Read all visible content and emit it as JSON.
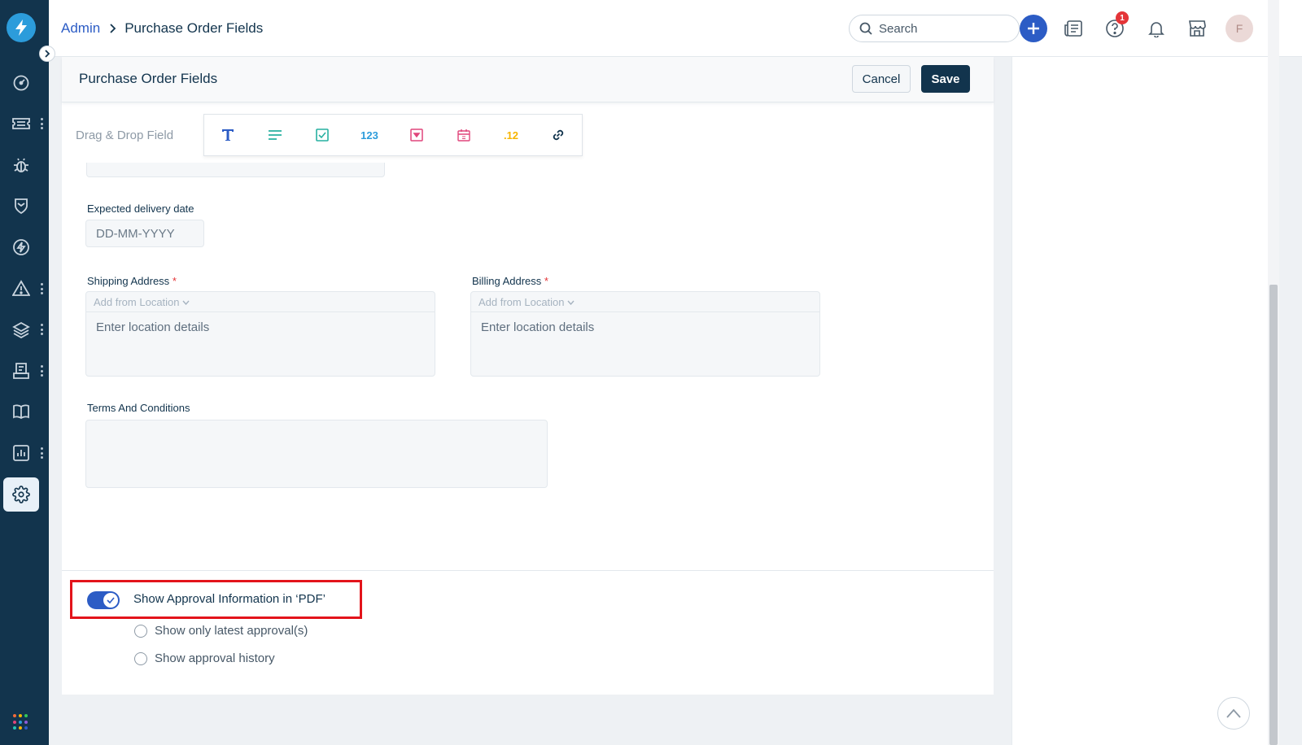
{
  "breadcrumb": {
    "parent": "Admin",
    "current": "Purchase Order Fields"
  },
  "search": {
    "placeholder": "Search"
  },
  "help": {
    "badge_count": "1"
  },
  "user": {
    "avatar_initial": "F"
  },
  "card": {
    "title": "Purchase Order Fields",
    "cancel_label": "Cancel",
    "save_label": "Save"
  },
  "toolbar": {
    "label": "Drag & Drop Field",
    "tools": [
      {
        "icon": "text-field-icon",
        "glyph": "T"
      },
      {
        "icon": "paragraph-field-icon",
        "glyph": ""
      },
      {
        "icon": "checkbox-field-icon",
        "glyph": ""
      },
      {
        "icon": "number-field-icon",
        "glyph": "123"
      },
      {
        "icon": "dropdown-field-icon",
        "glyph": ""
      },
      {
        "icon": "date-field-icon",
        "glyph": ""
      },
      {
        "icon": "decimal-field-icon",
        "glyph": ".12"
      },
      {
        "icon": "url-field-icon",
        "glyph": ""
      }
    ]
  },
  "fields": {
    "expected_delivery": {
      "label": "Expected delivery date",
      "placeholder": "DD-MM-YYYY"
    },
    "shipping": {
      "label": "Shipping Address",
      "required_mark": "*",
      "add_from": "Add from Location",
      "placeholder": "Enter location details"
    },
    "billing": {
      "label": "Billing Address",
      "required_mark": "*",
      "add_from": "Add from Location",
      "placeholder": "Enter location details"
    },
    "terms": {
      "label": "Terms And Conditions"
    }
  },
  "approval": {
    "toggle_label": "Show Approval Information in ‘PDF’",
    "toggle_on": true,
    "options": [
      "Show only latest approval(s)",
      "Show approval history"
    ]
  },
  "colors": {
    "sidebar": "#12344d",
    "accent": "#2c5cc5",
    "highlight": "#e3141b",
    "badge": "#e43538"
  },
  "sidebar": {
    "items": [
      {
        "icon": "dashboard-icon",
        "has_menu": false
      },
      {
        "icon": "ticket-icon",
        "has_menu": true
      },
      {
        "icon": "bug-icon",
        "has_menu": false
      },
      {
        "icon": "shield-icon",
        "has_menu": false
      },
      {
        "icon": "bolt-icon",
        "has_menu": false
      },
      {
        "icon": "alert-icon",
        "has_menu": true
      },
      {
        "icon": "layers-icon",
        "has_menu": true
      },
      {
        "icon": "purchase-icon",
        "has_menu": true
      },
      {
        "icon": "book-icon",
        "has_menu": false
      },
      {
        "icon": "reports-icon",
        "has_menu": true
      },
      {
        "icon": "settings-icon",
        "has_menu": false,
        "active": true
      }
    ]
  }
}
